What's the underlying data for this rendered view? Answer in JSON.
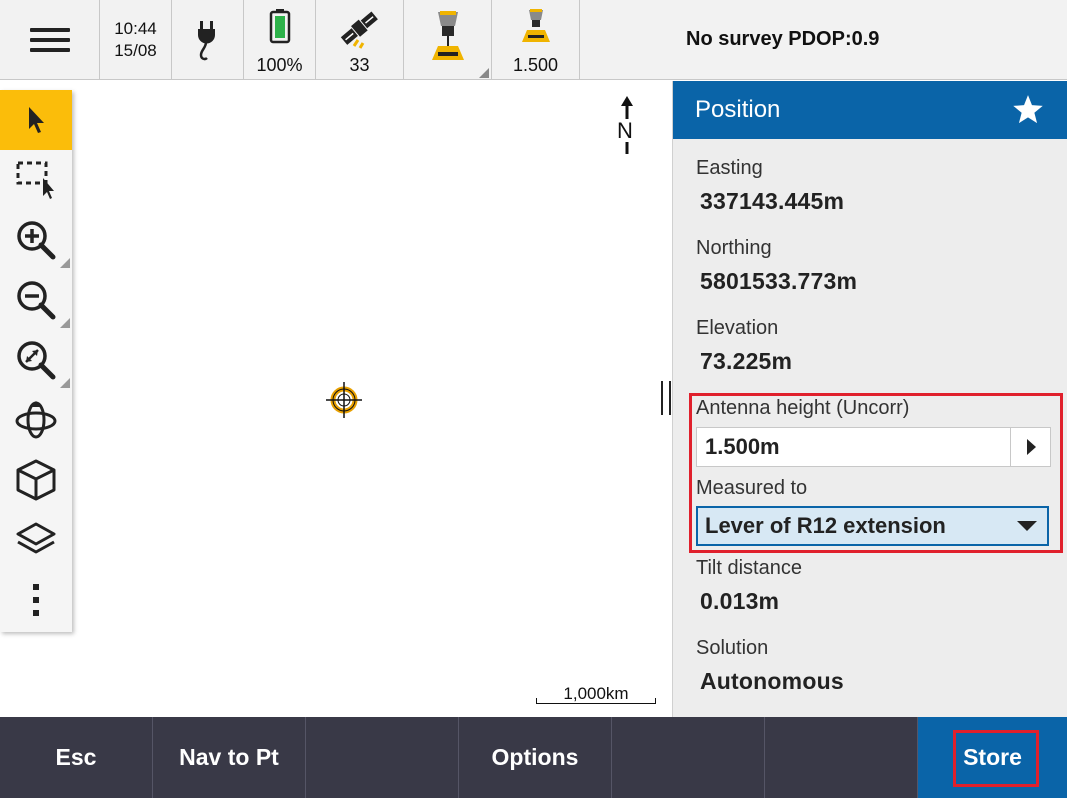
{
  "status_bar": {
    "time": "10:44",
    "date": "15/08",
    "battery": "100%",
    "satellites": "33",
    "antenna_height": "1.500"
  },
  "survey_status": "No survey  PDOP:0.9",
  "panel": {
    "title": "Position",
    "fields": {
      "easting_label": "Easting",
      "easting_value": "337143.445m",
      "northing_label": "Northing",
      "northing_value": "5801533.773m",
      "elevation_label": "Elevation",
      "elevation_value": "73.225m",
      "antenna_label": "Antenna height (Uncorr)",
      "antenna_value": "1.500m",
      "measured_label": "Measured to",
      "measured_value": "Lever of R12 extension",
      "tilt_label": "Tilt distance",
      "tilt_value": "0.013m",
      "solution_label": "Solution",
      "solution_value": "Autonomous"
    }
  },
  "map": {
    "north_label": "N",
    "scale_label": "1,000km"
  },
  "bottom_bar": {
    "esc": "Esc",
    "nav": "Nav to Pt",
    "blank1": "",
    "options": "Options",
    "blank2": "",
    "store": "Store"
  },
  "colors": {
    "accent_blue": "#0a64a8",
    "highlight_red": "#e0202c",
    "tool_active": "#fbbd0a",
    "bottom_bar": "#393947"
  },
  "icons": {
    "menu": "hamburger-icon",
    "power": "power-plug-icon",
    "battery": "battery-icon",
    "satellite": "satellite-icon",
    "rover": "gnss-receiver-icon",
    "antenna": "antenna-icon",
    "star": "star-icon"
  }
}
